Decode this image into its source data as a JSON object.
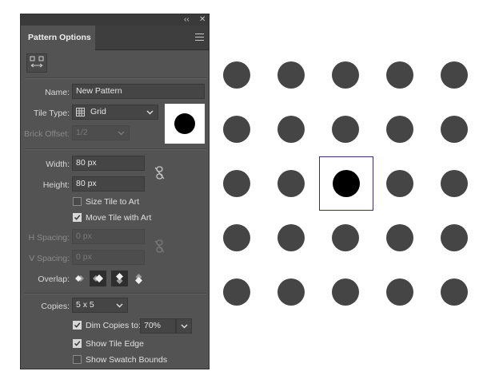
{
  "panel": {
    "tab_title": "Pattern Options",
    "titlebar_collapse": "‹‹",
    "titlebar_close": "✕",
    "tool_button_icon": "tile-editor-icon",
    "menu_icon": "hamburger-menu-icon"
  },
  "form": {
    "name_label": "Name:",
    "name_value": "New Pattern",
    "tile_type_label": "Tile Type:",
    "tile_type_value": "Grid",
    "tile_type_icon": "grid-icon",
    "brick_offset_label": "Brick Offset:",
    "brick_offset_value": "1/2",
    "width_label": "Width:",
    "width_value": "80 px",
    "height_label": "Height:",
    "height_value": "80 px",
    "size_tile_to_art": {
      "label": "Size Tile to Art",
      "checked": false
    },
    "move_tile_with_art": {
      "label": "Move Tile with Art",
      "checked": true
    },
    "h_spacing_label": "H Spacing:",
    "h_spacing_value": "0 px",
    "v_spacing_label": "V Spacing:",
    "v_spacing_value": "0 px",
    "overlap_label": "Overlap:",
    "copies_label": "Copies:",
    "copies_value": "5 x 5",
    "dim_copies": {
      "label": "Dim Copies to:",
      "checked": true,
      "value": "70%"
    },
    "show_tile_edge": {
      "label": "Show Tile Edge",
      "checked": true
    },
    "show_swatch_bounds": {
      "label": "Show Swatch Bounds",
      "checked": false
    }
  },
  "canvas": {
    "copies_rows": 5,
    "copies_cols": 5,
    "dot_color": "#454545",
    "tile_dot_color": "#000000",
    "tile_border_color": "#3d2a7c"
  }
}
